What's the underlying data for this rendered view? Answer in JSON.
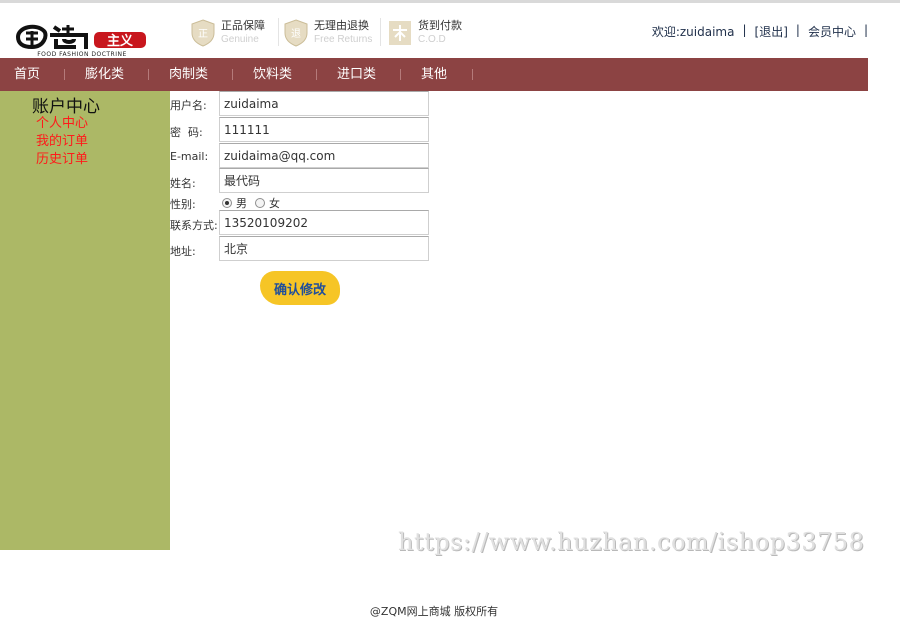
{
  "header": {
    "logo_text": "FOOD FASHION DOCTRINE",
    "badges": [
      {
        "zh": "正品保障",
        "en": "Genuine",
        "icon": "shield-zheng-icon"
      },
      {
        "zh": "无理由退换",
        "en": "Free Returns",
        "icon": "shield-tui-icon"
      },
      {
        "zh": "货到付款",
        "en": "C.O.D",
        "icon": "cod-icon"
      }
    ],
    "user": {
      "welcome": "欢迎:zuidaima",
      "logout": "[退出]",
      "member_center": "会员中心",
      "sep": "|"
    }
  },
  "nav": {
    "items": [
      "首页",
      "膨化类",
      "肉制类",
      "饮料类",
      "进口类",
      "其他"
    ]
  },
  "sidebar": {
    "title": "账户中心",
    "links": [
      "个人中心",
      "我的订单",
      "历史订单"
    ]
  },
  "form": {
    "username_label": "用户名:",
    "username_value": "zuidaima",
    "password_label": "密  码:",
    "password_value": "111111",
    "email_label": "E-mail:",
    "email_value": "zuidaima@qq.com",
    "name_label": "姓名:",
    "name_value": "最代码",
    "gender_label": "性别:",
    "gender_options": [
      "男",
      "女"
    ],
    "gender_selected": "男",
    "phone_label": "联系方式:",
    "phone_value": "13520109202",
    "address_label": "地址:",
    "address_value": "北京",
    "submit_label": "确认修改"
  },
  "watermark": "https://www.huzhan.com/ishop33758",
  "footer": "@ZQM网上商城 版权所有",
  "colors": {
    "nav_bg": "#8c4343",
    "sidebar_bg": "#acb866",
    "sidebar_link": "#ff1a1a",
    "button_bg": "#f6c526",
    "button_text": "#1f4e9b"
  }
}
